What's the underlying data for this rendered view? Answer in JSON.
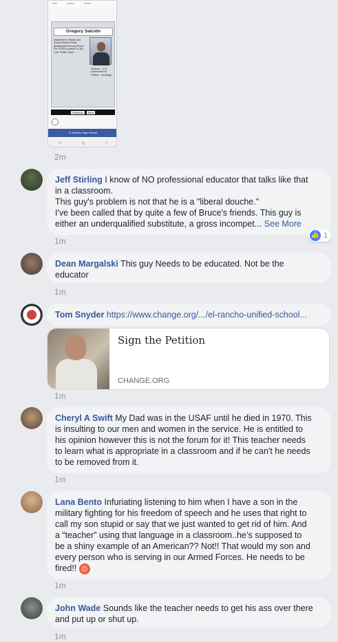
{
  "phone_shot": {
    "topbar": [
      "Sell",
      "Janos",
      "Select"
    ],
    "teacher_name": "Gregory Salcido",
    "dept_text": "Department: History and Social Studies  Email: gsalcido@erusd.org  Phone Ext: 57003 Location: A-100  Link: Twitter:  More...",
    "classes_text": "Classes: - U.S. Government & Politics - Sociology",
    "prev_label": "Previous",
    "next_label": "Next",
    "school_label": "El Rancho High School"
  },
  "comments": [
    {
      "author": "",
      "text": "",
      "time": "2m"
    },
    {
      "author": "Jeff Stirling",
      "text_l1": "I know of NO professional educator that talks like that",
      "text_l2": "in a classroom.",
      "text_l3": "This guy's problem is not that he is a \"liberal douche.\"",
      "text_l4": "I've been called that by quite a few of Bruce's friends. This guy is",
      "text_l5": "either an underqualified substitute, a gross incompet...",
      "see_more": "See More",
      "likes": "1",
      "time": "1m"
    },
    {
      "author": "Dean Margalski",
      "text_l1": "This guy Needs to be educated. Not be the",
      "text_l2": "educator",
      "time": "1m"
    },
    {
      "author": "Tom Snyder",
      "link": "https://www.change.org/.../el-rancho-unified-school...",
      "preview_title": "Sign the Petition",
      "preview_source": "CHANGE.ORG",
      "time": "1m"
    },
    {
      "author": "Cheryl A Swift",
      "text_l1": "My Dad was in the USAF until he died in 1970. This",
      "text_l2": "is insulting to our men and women in the service. He is entitled to",
      "text_l3": "his opinion however this is not the forum for it! This teacher needs",
      "text_l4": "to learn what is appropriate in a classroom and if he can't he needs",
      "text_l5": "to be removed from it.",
      "time": "1m"
    },
    {
      "author": "Lana Bento",
      "text_l1": "Infuriating listening to him when I have a son in the",
      "text_l2": "military fighting for his freedom of speech and he uses that right to",
      "text_l3": "call my son stupid or say that we just wanted to get rid of him. And",
      "text_l4": "a “teacher” using that language in a classroom..he’s supposed to",
      "text_l5": "be a shiny example of an American?? Not!! That would my son and",
      "text_l6": "every person who is serving in our Armed Forces. He needs to be",
      "text_l7": "fired!!",
      "time": "1m"
    },
    {
      "author": "John Wade",
      "text_l1": "Sounds like the teacher needs to get his ass over there",
      "text_l2": "and put up or shut up.",
      "time": "1m"
    }
  ],
  "colors": {
    "link_blue": "#385898",
    "bubble_bg": "#f2f3f5",
    "like_blue": "#4080ff"
  }
}
